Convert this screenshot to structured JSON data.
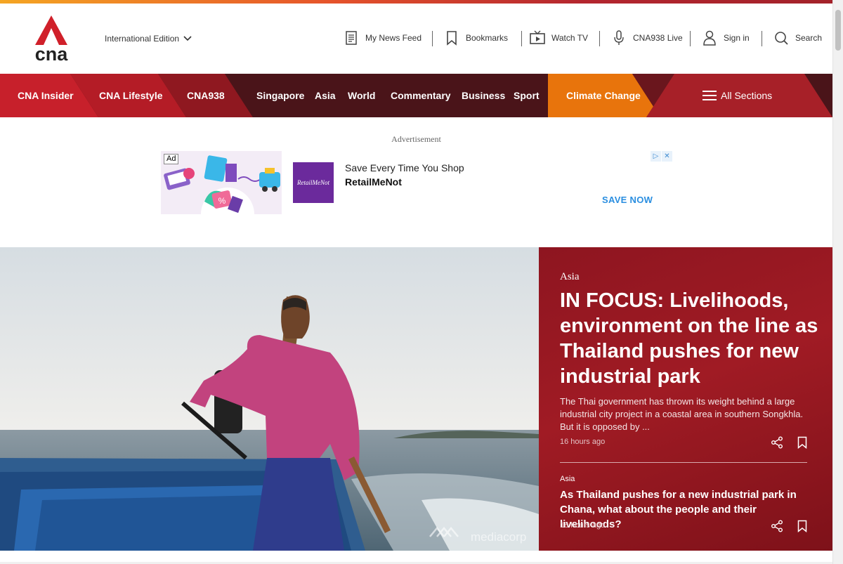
{
  "brand": {
    "logo_text": "cna",
    "accent": "#d0202a",
    "nav_dark": "#4a1419",
    "nav_red": "#c7202b",
    "nav_orange": "#e8740c"
  },
  "header": {
    "edition": "International Edition",
    "utilities": [
      {
        "icon": "news-feed-icon",
        "label": "My News Feed"
      },
      {
        "icon": "bookmark-icon",
        "label": "Bookmarks"
      },
      {
        "icon": "tv-icon",
        "label": "Watch TV"
      },
      {
        "icon": "microphone-icon",
        "label": "CNA938 Live"
      },
      {
        "icon": "user-icon",
        "label": "Sign in"
      },
      {
        "icon": "search-icon",
        "label": "Search"
      }
    ]
  },
  "nav": {
    "items": [
      {
        "label": "CNA Insider"
      },
      {
        "label": "CNA Lifestyle"
      },
      {
        "label": "CNA938"
      },
      {
        "label": "Singapore"
      },
      {
        "label": "Asia"
      },
      {
        "label": "World"
      },
      {
        "label": "Commentary"
      },
      {
        "label": "Business"
      },
      {
        "label": "Sport"
      },
      {
        "label": "Climate Change"
      }
    ],
    "all_sections": "All Sections"
  },
  "ad": {
    "label": "Advertisement",
    "badge": "Ad",
    "advertiser_logo": "RetailMeNot",
    "line1": "Save Every Time You Shop",
    "line2": "RetailMeNot",
    "cta": "SAVE NOW",
    "choices": [
      "▷",
      "✕"
    ]
  },
  "hero": {
    "kicker": "Asia",
    "headline": "IN FOCUS: Livelihoods, environment on the line as Thailand pushes for new industrial park",
    "summary": "The Thai government has thrown its weight behind a large industrial city project in a coastal area in southern Songkhla. But it is opposed by ...",
    "time": "16 hours ago",
    "image_watermark": "mediacorp",
    "secondary": {
      "kicker": "Asia",
      "headline": "As Thailand pushes for a new industrial park in Chana, what about the people and their livelihoods?",
      "time": "18 hours ago"
    }
  }
}
